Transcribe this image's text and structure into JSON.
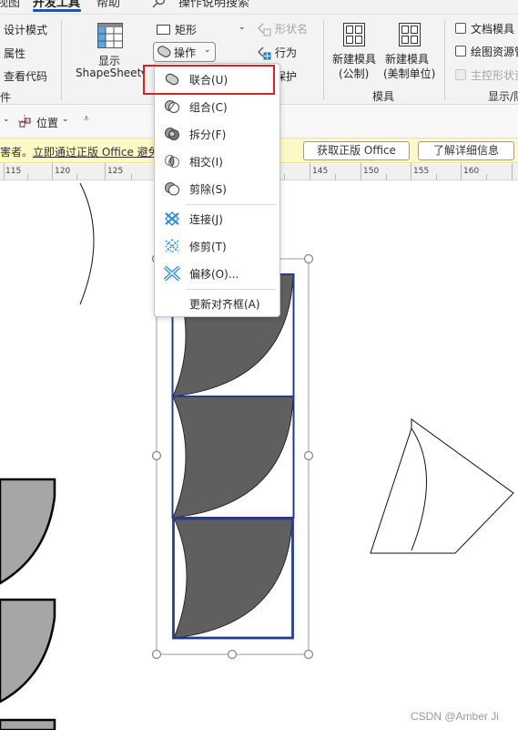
{
  "tabs": [
    {
      "label": "视图",
      "active": false
    },
    {
      "label": "开发工具",
      "active": true
    },
    {
      "label": "帮助",
      "active": false
    }
  ],
  "search": {
    "placeholder": "操作说明搜索",
    "icon": "search-icon"
  },
  "ribbon": {
    "controls_group": {
      "items": [
        "设计模式",
        "属性",
        "查看代码"
      ],
      "label_partial": "件"
    },
    "shapesheet": {
      "label_line1": "显示",
      "label_line2": "ShapeSheet"
    },
    "shape_design": {
      "rectangle": "矩形",
      "operations": "操作",
      "shape_name": "形状名",
      "behavior": "行为",
      "protect": "保护"
    },
    "stencil_group": {
      "new_metric": {
        "line1": "新建模具",
        "line2": "(公制)"
      },
      "new_us": {
        "line1": "新建模具",
        "line2": "(美制单位)"
      },
      "label": "模具"
    },
    "show_hide_group": {
      "doc_stencil": {
        "label": "文档模具",
        "checked": false,
        "enabled": true
      },
      "drawing_explorer": {
        "label": "绘图资源管",
        "checked": false,
        "enabled": true
      },
      "master_shape": {
        "label": "主控形状资",
        "checked": false,
        "enabled": false
      },
      "label": "显示/隐"
    }
  },
  "quick_toolbar": {
    "position_label": "位置"
  },
  "message_bar": {
    "text_prefix": "害者。",
    "link_text": "立即通过正版 Office 避免",
    "buttons": [
      "获取正版 Office",
      "了解详细信息"
    ]
  },
  "ruler": {
    "labels": [
      "115",
      "120",
      "125",
      "145",
      "150",
      "155",
      "160"
    ]
  },
  "operations_menu": {
    "items": [
      {
        "label": "联合(U)",
        "icon": "union-icon",
        "highlighted": true
      },
      {
        "label": "组合(C)",
        "icon": "combine-icon"
      },
      {
        "label": "拆分(F)",
        "icon": "fragment-icon"
      },
      {
        "label": "相交(I)",
        "icon": "intersect-icon"
      },
      {
        "label": "剪除(S)",
        "icon": "subtract-icon"
      },
      {
        "label": "连接(J)",
        "icon": "join-icon"
      },
      {
        "label": "修剪(T)",
        "icon": "trim-icon"
      },
      {
        "label": "偏移(O)...",
        "icon": "offset-icon"
      },
      {
        "label": "更新对齐框(A)",
        "icon": ""
      }
    ]
  },
  "colors": {
    "accent": "#1f56a8",
    "highlight_border": "#e02020",
    "selected_shape_outline": "#253c8c",
    "shape_fill_dark": "#5f5f5f",
    "shape_fill_light": "#a6a6a6",
    "message_bar_bg": "#fff8c7",
    "menu_icon_blue": "#2e8fd6"
  },
  "watermark": "CSDN @Amber Ji"
}
